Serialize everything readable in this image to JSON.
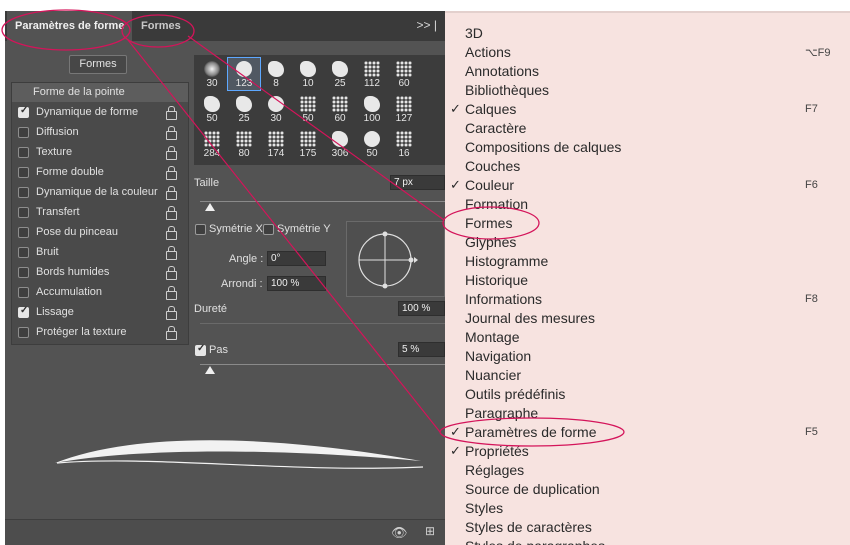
{
  "panel": {
    "tabs": [
      {
        "label": "Paramètres de forme",
        "active": true
      },
      {
        "label": "Formes",
        "active": false
      }
    ],
    "menu_icon": ">> |",
    "formes_button": "Formes",
    "tip_shape_label": "Forme de la pointe",
    "options": [
      {
        "label": "Dynamique de forme",
        "checked": true
      },
      {
        "label": "Diffusion",
        "checked": false
      },
      {
        "label": "Texture",
        "checked": false
      },
      {
        "label": "Forme double",
        "checked": false
      },
      {
        "label": "Dynamique de la couleur",
        "checked": false
      },
      {
        "label": "Transfert",
        "checked": false
      },
      {
        "label": "Pose du pinceau",
        "checked": false
      },
      {
        "label": "Bruit",
        "checked": false
      },
      {
        "label": "Bords humides",
        "checked": false
      },
      {
        "label": "Accumulation",
        "checked": false
      },
      {
        "label": "Lissage",
        "checked": true
      },
      {
        "label": "Protéger la texture",
        "checked": false
      }
    ],
    "brushes": [
      {
        "size": "30",
        "kind": "soft",
        "selected": false
      },
      {
        "size": "123",
        "kind": "hard",
        "selected": true
      },
      {
        "size": "8",
        "kind": "splat",
        "selected": false
      },
      {
        "size": "10",
        "kind": "splat",
        "selected": false
      },
      {
        "size": "25",
        "kind": "splat",
        "selected": false
      },
      {
        "size": "112",
        "kind": "dots",
        "selected": false
      },
      {
        "size": "60",
        "kind": "dots",
        "selected": false
      },
      {
        "size": "50",
        "kind": "splat",
        "selected": false
      },
      {
        "size": "25",
        "kind": "splat",
        "selected": false
      },
      {
        "size": "30",
        "kind": "hard",
        "selected": false
      },
      {
        "size": "50",
        "kind": "dots",
        "selected": false
      },
      {
        "size": "60",
        "kind": "dots",
        "selected": false
      },
      {
        "size": "100",
        "kind": "splat",
        "selected": false
      },
      {
        "size": "127",
        "kind": "dots",
        "selected": false
      },
      {
        "size": "284",
        "kind": "dots",
        "selected": false
      },
      {
        "size": "80",
        "kind": "dots",
        "selected": false
      },
      {
        "size": "174",
        "kind": "dots",
        "selected": false
      },
      {
        "size": "175",
        "kind": "dots",
        "selected": false
      },
      {
        "size": "306",
        "kind": "splat",
        "selected": false
      },
      {
        "size": "50",
        "kind": "hard",
        "selected": false
      },
      {
        "size": "16",
        "kind": "dots",
        "selected": false
      }
    ],
    "taille_label": "Taille",
    "taille_value": "7 px",
    "taille_level": 0.02,
    "symx_label": "Symétrie X",
    "symy_label": "Symétrie Y",
    "angle_label": "Angle :",
    "angle_value": "0°",
    "arrondi_label": "Arrondi :",
    "arrondi_value": "100 %",
    "durete_label": "Dureté",
    "durete_value": "100 %",
    "pas_label": "Pas",
    "pas_checked": true,
    "pas_value": "5 %",
    "pas_level": 0.02
  },
  "menu": {
    "items": [
      {
        "label": "3D",
        "check": false,
        "shortcut": ""
      },
      {
        "label": "Actions",
        "check": false,
        "shortcut": "⌥F9"
      },
      {
        "label": "Annotations",
        "check": false,
        "shortcut": ""
      },
      {
        "label": "Bibliothèques",
        "check": false,
        "shortcut": ""
      },
      {
        "label": "Calques",
        "check": true,
        "shortcut": "F7"
      },
      {
        "label": "Caractère",
        "check": false,
        "shortcut": ""
      },
      {
        "label": "Compositions de calques",
        "check": false,
        "shortcut": ""
      },
      {
        "label": "Couches",
        "check": false,
        "shortcut": ""
      },
      {
        "label": "Couleur",
        "check": true,
        "shortcut": "F6"
      },
      {
        "label": "Formation",
        "check": false,
        "shortcut": ""
      },
      {
        "label": "Formes",
        "check": false,
        "shortcut": ""
      },
      {
        "label": "Glyphes",
        "check": false,
        "shortcut": ""
      },
      {
        "label": "Histogramme",
        "check": false,
        "shortcut": ""
      },
      {
        "label": "Historique",
        "check": false,
        "shortcut": ""
      },
      {
        "label": "Informations",
        "check": false,
        "shortcut": "F8"
      },
      {
        "label": "Journal des mesures",
        "check": false,
        "shortcut": ""
      },
      {
        "label": "Montage",
        "check": false,
        "shortcut": ""
      },
      {
        "label": "Navigation",
        "check": false,
        "shortcut": ""
      },
      {
        "label": "Nuancier",
        "check": false,
        "shortcut": ""
      },
      {
        "label": "Outils prédéfinis",
        "check": false,
        "shortcut": ""
      },
      {
        "label": "Paragraphe",
        "check": false,
        "shortcut": ""
      },
      {
        "label": "Paramètres de forme",
        "check": true,
        "shortcut": "F5"
      },
      {
        "label": "Propriétés",
        "check": true,
        "shortcut": ""
      },
      {
        "label": "Réglages",
        "check": false,
        "shortcut": ""
      },
      {
        "label": "Source de duplication",
        "check": false,
        "shortcut": ""
      },
      {
        "label": "Styles",
        "check": false,
        "shortcut": ""
      },
      {
        "label": "Styles de caractères",
        "check": false,
        "shortcut": ""
      },
      {
        "label": "Styles de paragraphes",
        "check": false,
        "shortcut": ""
      }
    ]
  },
  "colors": {
    "annotation": "#d4145a",
    "menu_bg": "#f7e3e0",
    "panel_bg": "#535353"
  }
}
